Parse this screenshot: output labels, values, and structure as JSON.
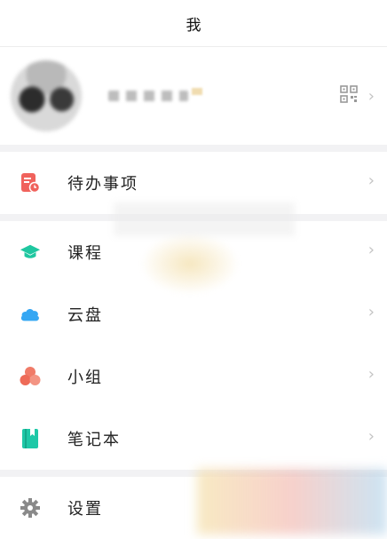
{
  "header": {
    "title": "我"
  },
  "profile": {
    "avatar_icon": "blurred-avatar",
    "qr_icon": "qr-code-icon",
    "chevron": "›"
  },
  "sections": {
    "todo": {
      "label": "待办事项",
      "icon": "todo-icon",
      "color": "#f0625c"
    },
    "course": {
      "label": "课程",
      "icon": "graduation-cap-icon",
      "color": "#1fc7a0"
    },
    "cloud": {
      "label": "云盘",
      "icon": "cloud-icon",
      "color": "#35a7f3"
    },
    "group": {
      "label": "小组",
      "icon": "group-icon",
      "color": "#f07b68"
    },
    "notebook": {
      "label": "笔记本",
      "icon": "notebook-icon",
      "color": "#1ec8a7"
    },
    "settings": {
      "label": "设置",
      "icon": "gear-icon",
      "color": "#8a8a8a"
    }
  },
  "chevron": "›"
}
